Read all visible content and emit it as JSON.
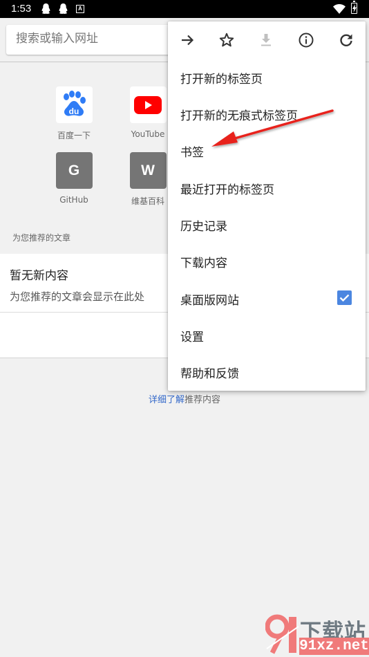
{
  "status_bar": {
    "time": "1:53",
    "icons": [
      "qq-icon",
      "qq-icon",
      "a-notification-icon",
      "wifi-icon",
      "battery-charging-icon"
    ],
    "a_label": "A"
  },
  "omnibox": {
    "placeholder": "搜索或输入网址",
    "value": ""
  },
  "tiles": [
    {
      "label": "百度一下",
      "icon": "baidu-icon"
    },
    {
      "label": "YouTube",
      "icon": "youtube-icon"
    },
    {
      "label": "GitHub",
      "icon": "letter-tile",
      "letter": "G"
    },
    {
      "label": "维基百科",
      "icon": "letter-tile",
      "letter": "W"
    }
  ],
  "articles": {
    "section_title": "为您推荐的文章",
    "empty_title": "暂无新内容",
    "empty_subtitle": "为您推荐的文章会显示在此处",
    "learn_more_link": "详细了解",
    "learn_more_suffix": "推荐内容"
  },
  "menu": {
    "icon_row": [
      {
        "name": "forward-icon",
        "enabled": true
      },
      {
        "name": "bookmark-star-icon",
        "enabled": true
      },
      {
        "name": "download-icon",
        "enabled": false
      },
      {
        "name": "info-icon",
        "enabled": true
      },
      {
        "name": "refresh-icon",
        "enabled": true
      }
    ],
    "items": [
      {
        "label": "打开新的标签页"
      },
      {
        "label": "打开新的无痕式标签页"
      },
      {
        "label": "书签"
      },
      {
        "label": "最近打开的标签页"
      },
      {
        "label": "历史记录"
      },
      {
        "label": "下载内容"
      },
      {
        "label": "桌面版网站",
        "checked": true
      },
      {
        "label": "设置"
      },
      {
        "label": "帮助和反馈"
      }
    ]
  },
  "annotation": {
    "type": "red-arrow",
    "points_to": "书签",
    "color": "#e8231f"
  },
  "watermark": {
    "line1": "下载站",
    "line2": "91xz.net",
    "logo_color": "#f07a7a",
    "text_color": "#6f7a82"
  },
  "colors": {
    "accent": "#4b86e0",
    "link": "#3469c9",
    "youtube_red": "#ff0000",
    "baidu_blue": "#2f7cf6"
  }
}
